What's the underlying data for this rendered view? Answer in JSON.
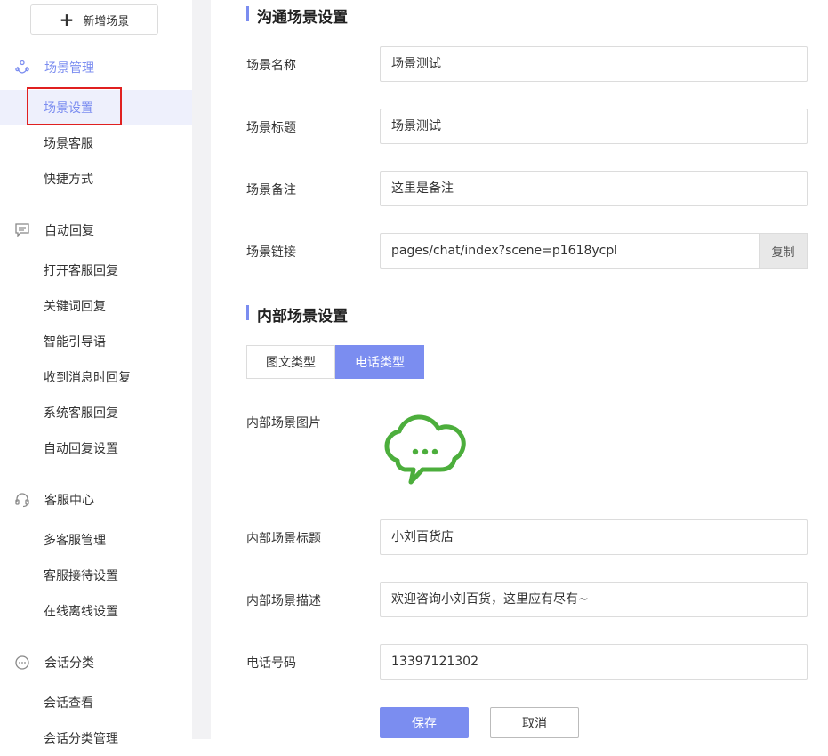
{
  "sidebar": {
    "add_button_label": "新增场景",
    "groups": [
      {
        "label": "场景管理",
        "icon": "scene-icon",
        "items": [
          "场景设置",
          "场景客服",
          "快捷方式"
        ]
      },
      {
        "label": "自动回复",
        "icon": "message-icon",
        "items": [
          "打开客服回复",
          "关键词回复",
          "智能引导语",
          "收到消息时回复",
          "系统客服回复",
          "自动回复设置"
        ]
      },
      {
        "label": "客服中心",
        "icon": "headset-icon",
        "items": [
          "多客服管理",
          "客服接待设置",
          "在线离线设置"
        ]
      },
      {
        "label": "会话分类",
        "icon": "chat-dots-icon",
        "items": [
          "会话查看",
          "会话分类管理"
        ]
      }
    ],
    "active_item": "场景设置"
  },
  "main": {
    "section1_title": "沟通场景设置",
    "fields": {
      "name": {
        "label": "场景名称",
        "value": "场景测试"
      },
      "title": {
        "label": "场景标题",
        "value": "场景测试"
      },
      "remark": {
        "label": "场景备注",
        "value": "这里是备注"
      },
      "link": {
        "label": "场景链接",
        "value": "pages/chat/index?scene=p1618ycpl",
        "copy_label": "复制"
      }
    },
    "section2_title": "内部场景设置",
    "tabs": [
      {
        "label": "图文类型",
        "active": false
      },
      {
        "label": "电话类型",
        "active": true
      }
    ],
    "inner": {
      "image_label": "内部场景图片",
      "title": {
        "label": "内部场景标题",
        "value": "小刘百货店"
      },
      "desc": {
        "label": "内部场景描述",
        "value": "欢迎咨询小刘百货，这里应有尽有~"
      },
      "phone": {
        "label": "电话号码",
        "value": "13397121302"
      }
    },
    "save_label": "保存",
    "cancel_label": "取消"
  },
  "colors": {
    "accent": "#7b8df0",
    "icon_green": "#4cae3c",
    "highlight_red": "#e02020"
  }
}
